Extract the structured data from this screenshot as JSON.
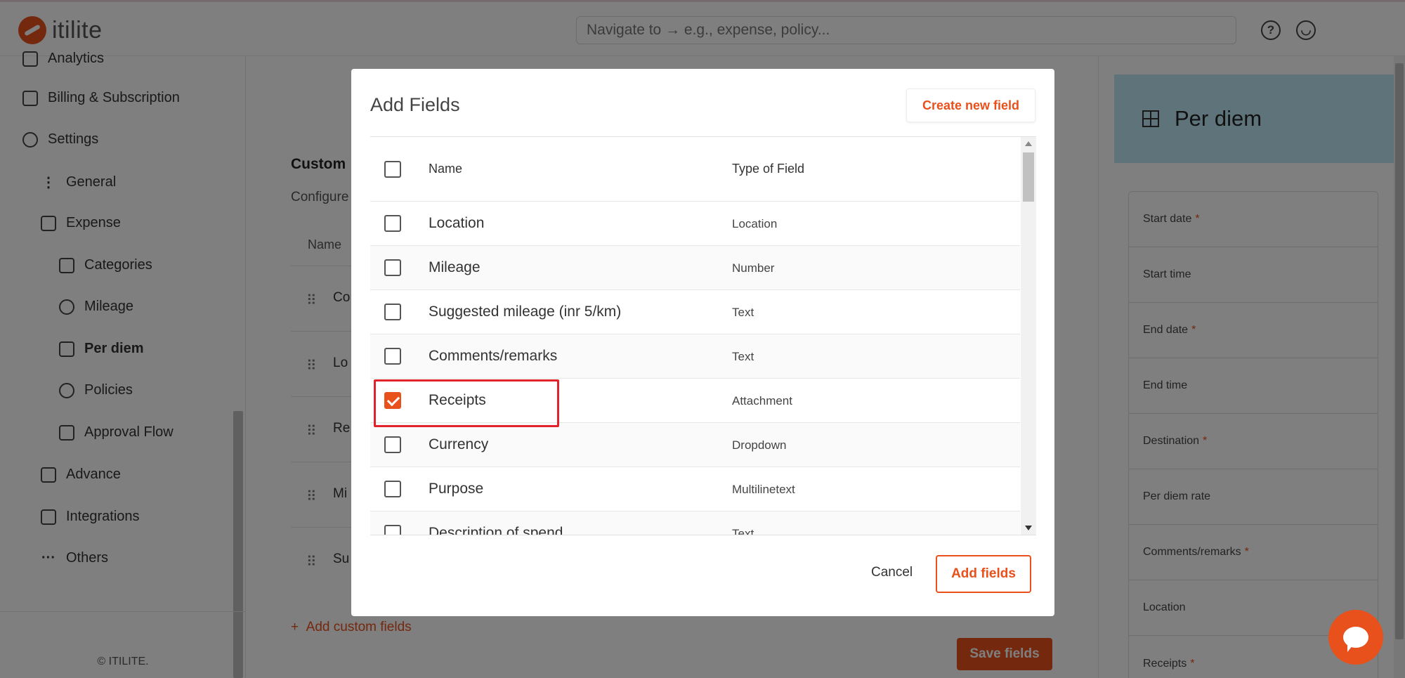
{
  "app": {
    "logo_text": "itilite"
  },
  "header": {
    "search_placeholder": "Navigate to → e.g., expense, policy..."
  },
  "sidebar": {
    "items": [
      {
        "label": "Analytics"
      },
      {
        "label": "Billing & Subscription"
      },
      {
        "label": "Settings"
      },
      {
        "label": "General"
      },
      {
        "label": "Expense"
      },
      {
        "label": "Categories"
      },
      {
        "label": "Mileage"
      },
      {
        "label": "Per diem"
      },
      {
        "label": "Policies"
      },
      {
        "label": "Approval Flow"
      },
      {
        "label": "Advance"
      },
      {
        "label": "Integrations"
      },
      {
        "label": "Others"
      }
    ],
    "footer": "© ITILITE."
  },
  "main": {
    "heading": "Custom",
    "subtext": "Configure",
    "column_name": "Name",
    "rows": [
      "Co",
      "Lo",
      "Re",
      "Mi",
      "Su"
    ],
    "add_custom_label": "Add custom fields",
    "save_label": "Save fields"
  },
  "preview": {
    "title": "Per diem",
    "fields": [
      {
        "label": "Start date",
        "required": "*"
      },
      {
        "label": "Start time",
        "required": ""
      },
      {
        "label": "End date",
        "required": "*"
      },
      {
        "label": "End time",
        "required": ""
      },
      {
        "label": "Destination",
        "required": "*"
      },
      {
        "label": "Per diem rate",
        "required": ""
      },
      {
        "label": "Comments/remarks",
        "required": "*"
      },
      {
        "label": "Location",
        "required": ""
      },
      {
        "label": "Receipts",
        "required": "*"
      }
    ]
  },
  "modal": {
    "title": "Add Fields",
    "create_label": "Create new field",
    "columns": {
      "name": "Name",
      "type": "Type of Field"
    },
    "rows": [
      {
        "name": "Location",
        "type": "Location",
        "checked": false
      },
      {
        "name": "Mileage",
        "type": "Number",
        "checked": false
      },
      {
        "name": "Suggested mileage (inr 5/km)",
        "type": "Text",
        "checked": false
      },
      {
        "name": "Comments/remarks",
        "type": "Text",
        "checked": false
      },
      {
        "name": "Receipts",
        "type": "Attachment",
        "checked": true
      },
      {
        "name": "Currency",
        "type": "Dropdown",
        "checked": false
      },
      {
        "name": "Purpose",
        "type": "Multilinetext",
        "checked": false
      },
      {
        "name": "Description of spend",
        "type": "Text",
        "checked": false
      }
    ],
    "cancel_label": "Cancel",
    "add_label": "Add fields"
  },
  "colors": {
    "accent": "#e8501c",
    "highlight": "#e3232c",
    "preview_header": "#bfe6f7"
  },
  "icons": [
    "help-icon",
    "user-icon",
    "chat-icon",
    "grid-icon",
    "drag-handle-icon"
  ]
}
